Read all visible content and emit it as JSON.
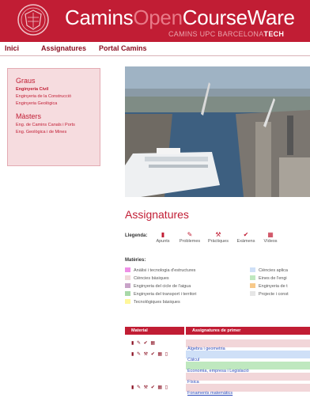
{
  "header": {
    "brand_part1": "Camins",
    "brand_part2": "Open",
    "brand_part3": "CourseWare",
    "subtitle_plain": "CAMINS UPC BARCELONA",
    "subtitle_bold": "TECH",
    "background": "#c11d34",
    "seal_icon": "university-seal-logo"
  },
  "nav": {
    "items": [
      {
        "label": "Inici"
      },
      {
        "label": "Assignatures"
      },
      {
        "label": "Portal Camins"
      }
    ]
  },
  "sidebar": {
    "graus_heading": "Graus",
    "graus": [
      {
        "label": "Enginyeria Civil",
        "active": true
      },
      {
        "label": "Enginyeria de la Construcció"
      },
      {
        "label": "Enginyeria Geològica"
      }
    ],
    "masters_heading": "Màsters",
    "masters": [
      {
        "label": "Eng. de Camins Canals i Ports"
      },
      {
        "label": "Eng. Geològica i de Mines"
      }
    ]
  },
  "main": {
    "title": "Assignatures",
    "legend": {
      "label": "Llegenda:",
      "items": [
        {
          "label": "Apunts",
          "icon": "book-icon",
          "glyph": "▮"
        },
        {
          "label": "Problemes",
          "icon": "pencil-icon",
          "glyph": "✎"
        },
        {
          "label": "Pràctiques",
          "icon": "hammer-icon",
          "glyph": "⚒"
        },
        {
          "label": "Exàmens",
          "icon": "check-icon",
          "glyph": "✔"
        },
        {
          "label": "Vídeos",
          "icon": "film-icon",
          "glyph": "▦"
        }
      ]
    },
    "materies": {
      "label": "Matèries:",
      "items": [
        {
          "label": "Anàlisi i tecnologia d'estructures",
          "color": "#ee8fe6"
        },
        {
          "label": "Ciències bàsiques",
          "color": "#f0d8da"
        },
        {
          "label": "Enginyeria del cicle de l'aigua",
          "color": "#c8a3c8"
        },
        {
          "label": "Enginyeria del transport i territori",
          "color": "#a8d8a8"
        },
        {
          "label": "Tecnològiques bàsiques",
          "color": "#fff79a"
        },
        {
          "label": "Ciències aplica",
          "color": "#cfe0f7"
        },
        {
          "label": "Eines de l'engi",
          "color": "#bfe8bf"
        },
        {
          "label": "Enginyeria de t",
          "color": "#f7c98a"
        },
        {
          "label": "Projecte i const",
          "color": "#e6e6e6"
        }
      ]
    },
    "table": {
      "header_material": "Material",
      "header_subjects": "Assignatures de primer",
      "rows": [
        {
          "material": "▮ ✎ ✔ ▦",
          "subject": "Àlgebra i geometria",
          "bg": "#f2d6d9"
        },
        {
          "material": "▮ ✎ ⚒ ✔ ▦ ▯",
          "subject": "Càlcul",
          "bg": "#cfe0f7"
        },
        {
          "material": "",
          "subject": "Economia, empresa i Legislació",
          "bg": "#bfe8bf"
        },
        {
          "material": "",
          "subject": "Física",
          "bg": "#f2d6d9"
        },
        {
          "material": "▮ ✎ ⚒ ✔ ▦ ▯",
          "subject": "Fonaments matemàtics",
          "bg": "#f2d6d9"
        }
      ]
    }
  }
}
